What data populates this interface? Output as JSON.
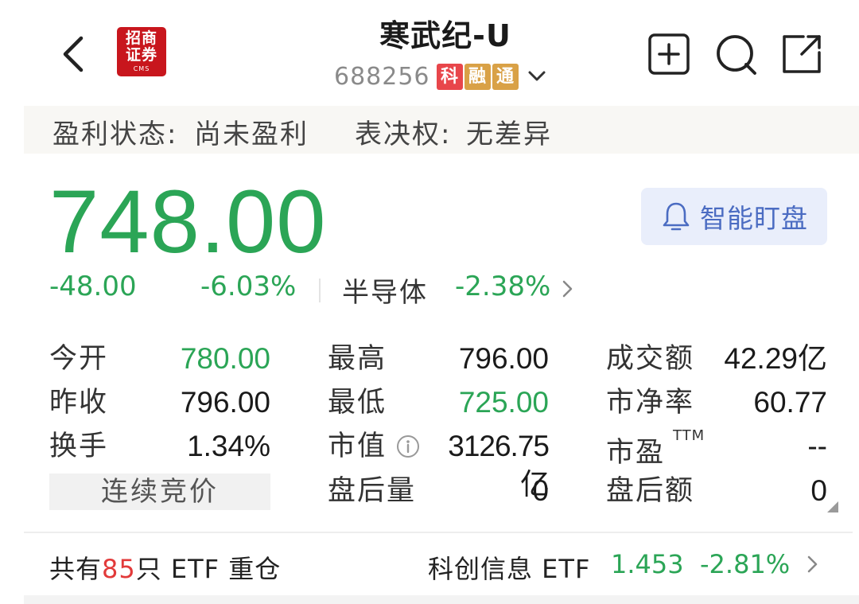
{
  "header": {
    "back_icon": "chevron-left-icon",
    "logo": {
      "line1": "招商",
      "line2": "证券",
      "line3": "CMS",
      "color": "#c8161d"
    },
    "stock_name": "寒武纪-U",
    "stock_code": "688256",
    "tags": [
      "科",
      "融",
      "通"
    ],
    "actions": [
      "add-watchlist-icon",
      "search-icon",
      "share-icon"
    ]
  },
  "status": {
    "profit_label": "盈利状态:",
    "profit_value": "尚未盈利",
    "voting_label": "表决权:",
    "voting_value": "无差异"
  },
  "quote": {
    "price": "748.00",
    "change": "-48.00",
    "change_pct": "-6.03%",
    "sector_name": "半导体",
    "sector_change": "-2.38%",
    "watch_label": "智能盯盘",
    "down_color": "#2ba556"
  },
  "stats": {
    "open_label": "今开",
    "open_value": "780.00",
    "prev_close_label": "昨收",
    "prev_close_value": "796.00",
    "turnover_label": "换手",
    "turnover_value": "1.34%",
    "auction_label": "连续竞价",
    "high_label": "最高",
    "high_value": "796.00",
    "low_label": "最低",
    "low_value": "725.00",
    "mcap_label": "市值",
    "mcap_value": "3126.75亿",
    "after_vol_label": "盘后量",
    "after_vol_value": "0",
    "amount_label": "成交额",
    "amount_value": "42.29亿",
    "pb_label": "市净率",
    "pb_value": "60.77",
    "pe_label": "市盈",
    "pe_sup": "TTM",
    "pe_value": "--",
    "after_amt_label": "盘后额",
    "after_amt_value": "0"
  },
  "etf": {
    "prefix": "共有",
    "count": "85",
    "suffix": "只 ETF 重仓",
    "name": "科创信息 ETF",
    "price": "1.453",
    "change_pct": "-2.81%"
  }
}
